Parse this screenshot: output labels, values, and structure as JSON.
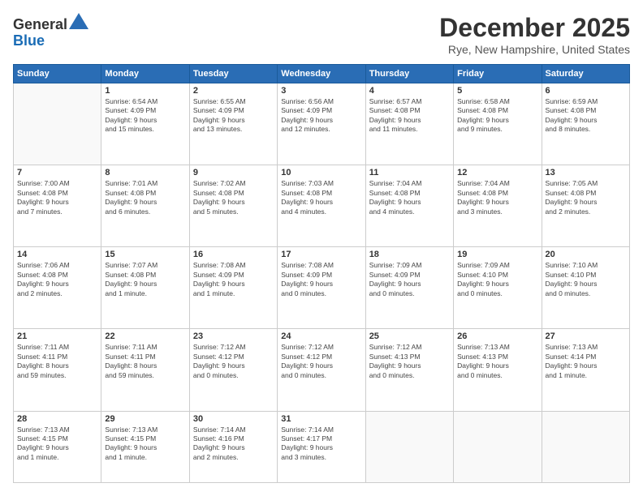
{
  "header": {
    "logo_general": "General",
    "logo_blue": "Blue",
    "month": "December 2025",
    "location": "Rye, New Hampshire, United States"
  },
  "weekdays": [
    "Sunday",
    "Monday",
    "Tuesday",
    "Wednesday",
    "Thursday",
    "Friday",
    "Saturday"
  ],
  "weeks": [
    [
      {
        "day": "",
        "info": ""
      },
      {
        "day": "1",
        "info": "Sunrise: 6:54 AM\nSunset: 4:09 PM\nDaylight: 9 hours\nand 15 minutes."
      },
      {
        "day": "2",
        "info": "Sunrise: 6:55 AM\nSunset: 4:09 PM\nDaylight: 9 hours\nand 13 minutes."
      },
      {
        "day": "3",
        "info": "Sunrise: 6:56 AM\nSunset: 4:09 PM\nDaylight: 9 hours\nand 12 minutes."
      },
      {
        "day": "4",
        "info": "Sunrise: 6:57 AM\nSunset: 4:08 PM\nDaylight: 9 hours\nand 11 minutes."
      },
      {
        "day": "5",
        "info": "Sunrise: 6:58 AM\nSunset: 4:08 PM\nDaylight: 9 hours\nand 9 minutes."
      },
      {
        "day": "6",
        "info": "Sunrise: 6:59 AM\nSunset: 4:08 PM\nDaylight: 9 hours\nand 8 minutes."
      }
    ],
    [
      {
        "day": "7",
        "info": "Sunrise: 7:00 AM\nSunset: 4:08 PM\nDaylight: 9 hours\nand 7 minutes."
      },
      {
        "day": "8",
        "info": "Sunrise: 7:01 AM\nSunset: 4:08 PM\nDaylight: 9 hours\nand 6 minutes."
      },
      {
        "day": "9",
        "info": "Sunrise: 7:02 AM\nSunset: 4:08 PM\nDaylight: 9 hours\nand 5 minutes."
      },
      {
        "day": "10",
        "info": "Sunrise: 7:03 AM\nSunset: 4:08 PM\nDaylight: 9 hours\nand 4 minutes."
      },
      {
        "day": "11",
        "info": "Sunrise: 7:04 AM\nSunset: 4:08 PM\nDaylight: 9 hours\nand 4 minutes."
      },
      {
        "day": "12",
        "info": "Sunrise: 7:04 AM\nSunset: 4:08 PM\nDaylight: 9 hours\nand 3 minutes."
      },
      {
        "day": "13",
        "info": "Sunrise: 7:05 AM\nSunset: 4:08 PM\nDaylight: 9 hours\nand 2 minutes."
      }
    ],
    [
      {
        "day": "14",
        "info": "Sunrise: 7:06 AM\nSunset: 4:08 PM\nDaylight: 9 hours\nand 2 minutes."
      },
      {
        "day": "15",
        "info": "Sunrise: 7:07 AM\nSunset: 4:08 PM\nDaylight: 9 hours\nand 1 minute."
      },
      {
        "day": "16",
        "info": "Sunrise: 7:08 AM\nSunset: 4:09 PM\nDaylight: 9 hours\nand 1 minute."
      },
      {
        "day": "17",
        "info": "Sunrise: 7:08 AM\nSunset: 4:09 PM\nDaylight: 9 hours\nand 0 minutes."
      },
      {
        "day": "18",
        "info": "Sunrise: 7:09 AM\nSunset: 4:09 PM\nDaylight: 9 hours\nand 0 minutes."
      },
      {
        "day": "19",
        "info": "Sunrise: 7:09 AM\nSunset: 4:10 PM\nDaylight: 9 hours\nand 0 minutes."
      },
      {
        "day": "20",
        "info": "Sunrise: 7:10 AM\nSunset: 4:10 PM\nDaylight: 9 hours\nand 0 minutes."
      }
    ],
    [
      {
        "day": "21",
        "info": "Sunrise: 7:11 AM\nSunset: 4:11 PM\nDaylight: 8 hours\nand 59 minutes."
      },
      {
        "day": "22",
        "info": "Sunrise: 7:11 AM\nSunset: 4:11 PM\nDaylight: 8 hours\nand 59 minutes."
      },
      {
        "day": "23",
        "info": "Sunrise: 7:12 AM\nSunset: 4:12 PM\nDaylight: 9 hours\nand 0 minutes."
      },
      {
        "day": "24",
        "info": "Sunrise: 7:12 AM\nSunset: 4:12 PM\nDaylight: 9 hours\nand 0 minutes."
      },
      {
        "day": "25",
        "info": "Sunrise: 7:12 AM\nSunset: 4:13 PM\nDaylight: 9 hours\nand 0 minutes."
      },
      {
        "day": "26",
        "info": "Sunrise: 7:13 AM\nSunset: 4:13 PM\nDaylight: 9 hours\nand 0 minutes."
      },
      {
        "day": "27",
        "info": "Sunrise: 7:13 AM\nSunset: 4:14 PM\nDaylight: 9 hours\nand 1 minute."
      }
    ],
    [
      {
        "day": "28",
        "info": "Sunrise: 7:13 AM\nSunset: 4:15 PM\nDaylight: 9 hours\nand 1 minute."
      },
      {
        "day": "29",
        "info": "Sunrise: 7:13 AM\nSunset: 4:15 PM\nDaylight: 9 hours\nand 1 minute."
      },
      {
        "day": "30",
        "info": "Sunrise: 7:14 AM\nSunset: 4:16 PM\nDaylight: 9 hours\nand 2 minutes."
      },
      {
        "day": "31",
        "info": "Sunrise: 7:14 AM\nSunset: 4:17 PM\nDaylight: 9 hours\nand 3 minutes."
      },
      {
        "day": "",
        "info": ""
      },
      {
        "day": "",
        "info": ""
      },
      {
        "day": "",
        "info": ""
      }
    ]
  ]
}
